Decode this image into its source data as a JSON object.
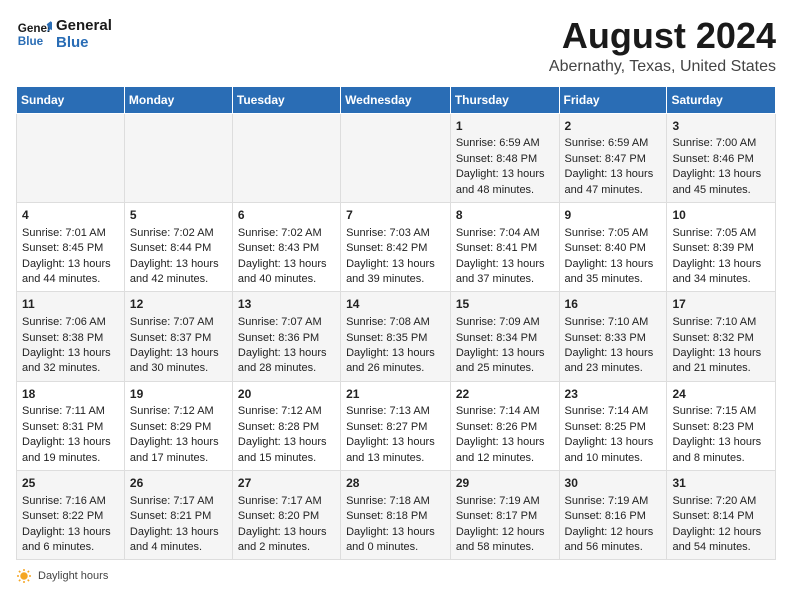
{
  "logo": {
    "line1": "General",
    "line2": "Blue"
  },
  "title": "August 2024",
  "subtitle": "Abernathy, Texas, United States",
  "days_header": [
    "Sunday",
    "Monday",
    "Tuesday",
    "Wednesday",
    "Thursday",
    "Friday",
    "Saturday"
  ],
  "weeks": [
    [
      {
        "day": "",
        "info": ""
      },
      {
        "day": "",
        "info": ""
      },
      {
        "day": "",
        "info": ""
      },
      {
        "day": "",
        "info": ""
      },
      {
        "day": "1",
        "info": "Sunrise: 6:59 AM\nSunset: 8:48 PM\nDaylight: 13 hours and 48 minutes."
      },
      {
        "day": "2",
        "info": "Sunrise: 6:59 AM\nSunset: 8:47 PM\nDaylight: 13 hours and 47 minutes."
      },
      {
        "day": "3",
        "info": "Sunrise: 7:00 AM\nSunset: 8:46 PM\nDaylight: 13 hours and 45 minutes."
      }
    ],
    [
      {
        "day": "4",
        "info": "Sunrise: 7:01 AM\nSunset: 8:45 PM\nDaylight: 13 hours and 44 minutes."
      },
      {
        "day": "5",
        "info": "Sunrise: 7:02 AM\nSunset: 8:44 PM\nDaylight: 13 hours and 42 minutes."
      },
      {
        "day": "6",
        "info": "Sunrise: 7:02 AM\nSunset: 8:43 PM\nDaylight: 13 hours and 40 minutes."
      },
      {
        "day": "7",
        "info": "Sunrise: 7:03 AM\nSunset: 8:42 PM\nDaylight: 13 hours and 39 minutes."
      },
      {
        "day": "8",
        "info": "Sunrise: 7:04 AM\nSunset: 8:41 PM\nDaylight: 13 hours and 37 minutes."
      },
      {
        "day": "9",
        "info": "Sunrise: 7:05 AM\nSunset: 8:40 PM\nDaylight: 13 hours and 35 minutes."
      },
      {
        "day": "10",
        "info": "Sunrise: 7:05 AM\nSunset: 8:39 PM\nDaylight: 13 hours and 34 minutes."
      }
    ],
    [
      {
        "day": "11",
        "info": "Sunrise: 7:06 AM\nSunset: 8:38 PM\nDaylight: 13 hours and 32 minutes."
      },
      {
        "day": "12",
        "info": "Sunrise: 7:07 AM\nSunset: 8:37 PM\nDaylight: 13 hours and 30 minutes."
      },
      {
        "day": "13",
        "info": "Sunrise: 7:07 AM\nSunset: 8:36 PM\nDaylight: 13 hours and 28 minutes."
      },
      {
        "day": "14",
        "info": "Sunrise: 7:08 AM\nSunset: 8:35 PM\nDaylight: 13 hours and 26 minutes."
      },
      {
        "day": "15",
        "info": "Sunrise: 7:09 AM\nSunset: 8:34 PM\nDaylight: 13 hours and 25 minutes."
      },
      {
        "day": "16",
        "info": "Sunrise: 7:10 AM\nSunset: 8:33 PM\nDaylight: 13 hours and 23 minutes."
      },
      {
        "day": "17",
        "info": "Sunrise: 7:10 AM\nSunset: 8:32 PM\nDaylight: 13 hours and 21 minutes."
      }
    ],
    [
      {
        "day": "18",
        "info": "Sunrise: 7:11 AM\nSunset: 8:31 PM\nDaylight: 13 hours and 19 minutes."
      },
      {
        "day": "19",
        "info": "Sunrise: 7:12 AM\nSunset: 8:29 PM\nDaylight: 13 hours and 17 minutes."
      },
      {
        "day": "20",
        "info": "Sunrise: 7:12 AM\nSunset: 8:28 PM\nDaylight: 13 hours and 15 minutes."
      },
      {
        "day": "21",
        "info": "Sunrise: 7:13 AM\nSunset: 8:27 PM\nDaylight: 13 hours and 13 minutes."
      },
      {
        "day": "22",
        "info": "Sunrise: 7:14 AM\nSunset: 8:26 PM\nDaylight: 13 hours and 12 minutes."
      },
      {
        "day": "23",
        "info": "Sunrise: 7:14 AM\nSunset: 8:25 PM\nDaylight: 13 hours and 10 minutes."
      },
      {
        "day": "24",
        "info": "Sunrise: 7:15 AM\nSunset: 8:23 PM\nDaylight: 13 hours and 8 minutes."
      }
    ],
    [
      {
        "day": "25",
        "info": "Sunrise: 7:16 AM\nSunset: 8:22 PM\nDaylight: 13 hours and 6 minutes."
      },
      {
        "day": "26",
        "info": "Sunrise: 7:17 AM\nSunset: 8:21 PM\nDaylight: 13 hours and 4 minutes."
      },
      {
        "day": "27",
        "info": "Sunrise: 7:17 AM\nSunset: 8:20 PM\nDaylight: 13 hours and 2 minutes."
      },
      {
        "day": "28",
        "info": "Sunrise: 7:18 AM\nSunset: 8:18 PM\nDaylight: 13 hours and 0 minutes."
      },
      {
        "day": "29",
        "info": "Sunrise: 7:19 AM\nSunset: 8:17 PM\nDaylight: 12 hours and 58 minutes."
      },
      {
        "day": "30",
        "info": "Sunrise: 7:19 AM\nSunset: 8:16 PM\nDaylight: 12 hours and 56 minutes."
      },
      {
        "day": "31",
        "info": "Sunrise: 7:20 AM\nSunset: 8:14 PM\nDaylight: 12 hours and 54 minutes."
      }
    ]
  ],
  "footer": {
    "label": "Daylight hours"
  }
}
